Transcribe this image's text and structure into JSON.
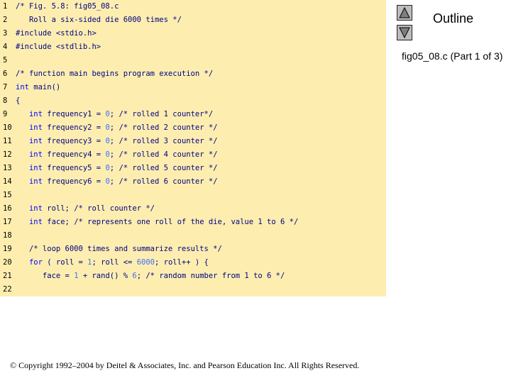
{
  "code_lines": [
    {
      "num": "1",
      "parts": [
        [
          "c",
          "/* Fig. 5.8: fig05_08.c"
        ]
      ]
    },
    {
      "num": "2",
      "parts": [
        [
          "c",
          "   Roll a six-sided die 6000 times */"
        ]
      ]
    },
    {
      "num": "3",
      "parts": [
        [
          "t",
          "#include <stdio.h>"
        ]
      ]
    },
    {
      "num": "4",
      "parts": [
        [
          "t",
          "#include <stdlib.h>"
        ]
      ]
    },
    {
      "num": "5",
      "parts": []
    },
    {
      "num": "6",
      "parts": [
        [
          "c",
          "/* function main begins program execution */"
        ]
      ]
    },
    {
      "num": "7",
      "parts": [
        [
          "k",
          "int"
        ],
        [
          "t",
          " main()"
        ]
      ]
    },
    {
      "num": "8",
      "parts": [
        [
          "t",
          "{"
        ]
      ]
    },
    {
      "num": "9",
      "parts": [
        [
          "t",
          "   "
        ],
        [
          "k",
          "int"
        ],
        [
          "t",
          " frequency1 = "
        ],
        [
          "l",
          "0"
        ],
        [
          "t",
          "; "
        ],
        [
          "c",
          "/* rolled 1 counter*/"
        ]
      ]
    },
    {
      "num": "10",
      "parts": [
        [
          "t",
          "   "
        ],
        [
          "k",
          "int"
        ],
        [
          "t",
          " frequency2 = "
        ],
        [
          "l",
          "0"
        ],
        [
          "t",
          "; "
        ],
        [
          "c",
          "/* rolled 2 counter */"
        ]
      ]
    },
    {
      "num": "11",
      "parts": [
        [
          "t",
          "   "
        ],
        [
          "k",
          "int"
        ],
        [
          "t",
          " frequency3 = "
        ],
        [
          "l",
          "0"
        ],
        [
          "t",
          "; "
        ],
        [
          "c",
          "/* rolled 3 counter */"
        ]
      ]
    },
    {
      "num": "12",
      "parts": [
        [
          "t",
          "   "
        ],
        [
          "k",
          "int"
        ],
        [
          "t",
          " frequency4 = "
        ],
        [
          "l",
          "0"
        ],
        [
          "t",
          "; "
        ],
        [
          "c",
          "/* rolled 4 counter */"
        ]
      ]
    },
    {
      "num": "13",
      "parts": [
        [
          "t",
          "   "
        ],
        [
          "k",
          "int"
        ],
        [
          "t",
          " frequency5 = "
        ],
        [
          "l",
          "0"
        ],
        [
          "t",
          "; "
        ],
        [
          "c",
          "/* rolled 5 counter */"
        ]
      ]
    },
    {
      "num": "14",
      "parts": [
        [
          "t",
          "   "
        ],
        [
          "k",
          "int"
        ],
        [
          "t",
          " frequency6 = "
        ],
        [
          "l",
          "0"
        ],
        [
          "t",
          "; "
        ],
        [
          "c",
          "/* rolled 6 counter */"
        ]
      ]
    },
    {
      "num": "15",
      "parts": []
    },
    {
      "num": "16",
      "parts": [
        [
          "t",
          "   "
        ],
        [
          "k",
          "int"
        ],
        [
          "t",
          " roll; "
        ],
        [
          "c",
          "/* roll counter */"
        ]
      ]
    },
    {
      "num": "17",
      "parts": [
        [
          "t",
          "   "
        ],
        [
          "k",
          "int"
        ],
        [
          "t",
          " face; "
        ],
        [
          "c",
          "/* represents one roll of the die, value 1 to 6 */"
        ]
      ]
    },
    {
      "num": "18",
      "parts": []
    },
    {
      "num": "19",
      "parts": [
        [
          "t",
          "   "
        ],
        [
          "c",
          "/* loop 6000 times and summarize results */"
        ]
      ]
    },
    {
      "num": "20",
      "parts": [
        [
          "t",
          "   "
        ],
        [
          "k",
          "for"
        ],
        [
          "t",
          " ( roll = "
        ],
        [
          "l",
          "1"
        ],
        [
          "t",
          "; roll <= "
        ],
        [
          "l",
          "6000"
        ],
        [
          "t",
          "; roll++ ) {"
        ]
      ]
    },
    {
      "num": "21",
      "parts": [
        [
          "t",
          "      face = "
        ],
        [
          "l",
          "1"
        ],
        [
          "t",
          " + rand() % "
        ],
        [
          "l",
          "6"
        ],
        [
          "t",
          "; "
        ],
        [
          "c",
          "/* random number from 1 to 6 */"
        ]
      ]
    },
    {
      "num": "22",
      "parts": []
    }
  ],
  "sidebar": {
    "outline_label": "Outline",
    "caption": "fig05_08.c (Part 1 of 3)",
    "up_button_icon": "triangle-up-icon",
    "down_button_icon": "triangle-down-icon"
  },
  "footer": {
    "copyright": "© Copyright 1992–2004 by Deitel & Associates, Inc. and Pearson Education Inc. All Rights Reserved."
  },
  "colors": {
    "code_background": "#fdeeb0",
    "comment": "#000080",
    "keyword": "#0000ff",
    "literal": "#3f6fff"
  }
}
